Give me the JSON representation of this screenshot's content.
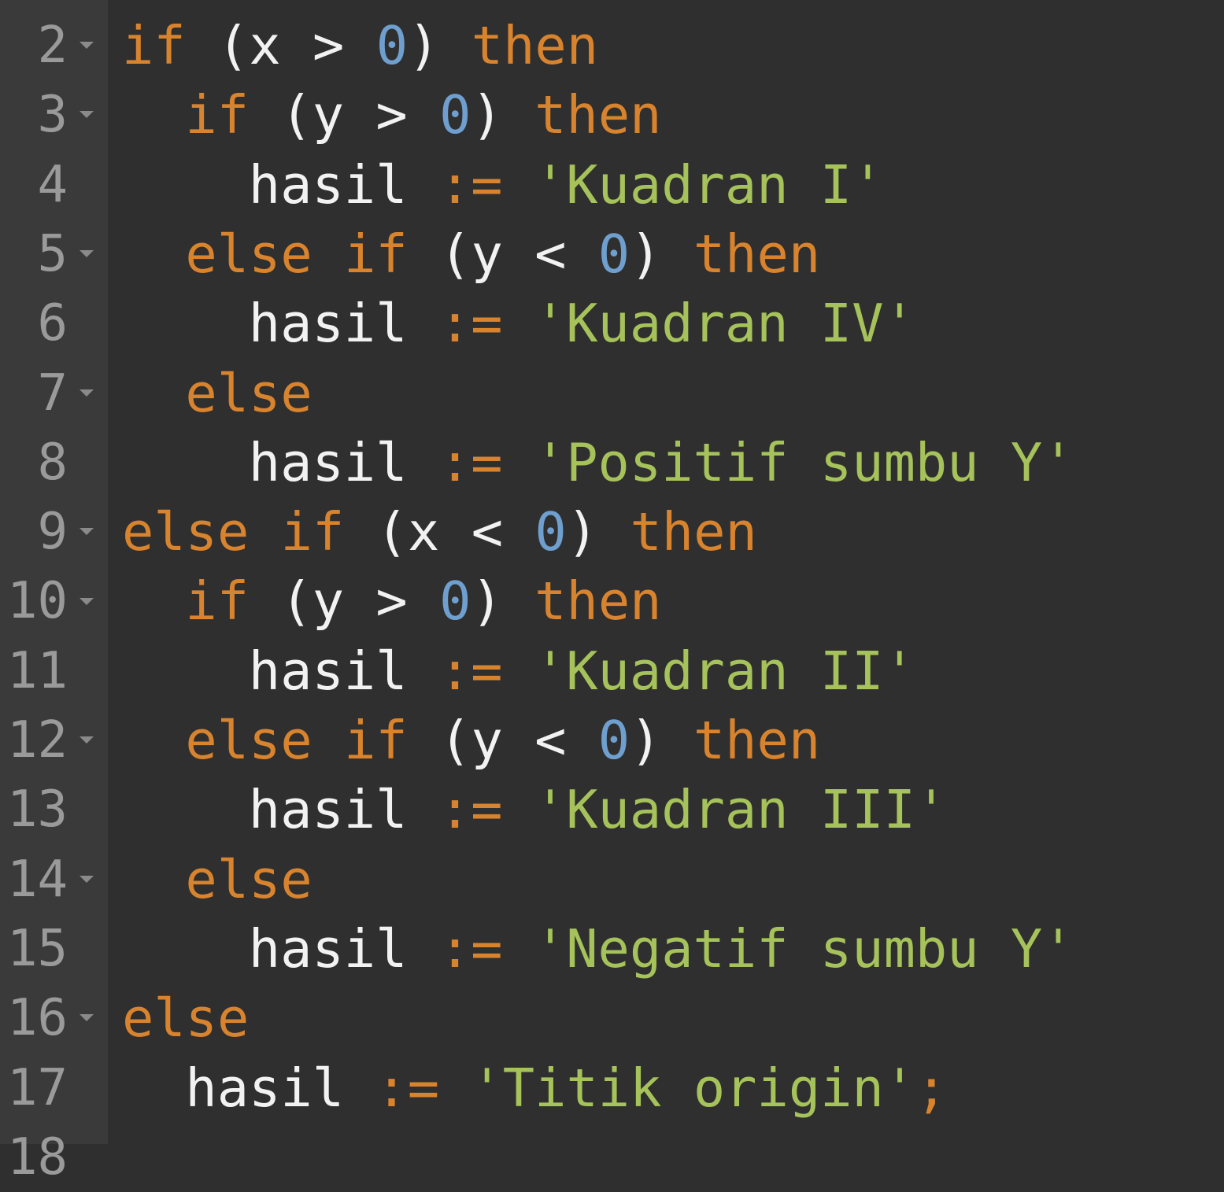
{
  "editor": {
    "colors": {
      "background": "#2f2f2f",
      "gutter": "#3a3a3a",
      "keyword": "#d8832e",
      "number": "#6f9fcf",
      "string": "#a6c25a",
      "text": "#f2f2f2"
    },
    "lines": [
      {
        "n": "2",
        "fold": true,
        "indent": 0,
        "tokens": [
          {
            "t": "if",
            "c": "kw"
          },
          {
            "t": " (x > ",
            "c": "plain"
          },
          {
            "t": "0",
            "c": "num"
          },
          {
            "t": ") ",
            "c": "plain"
          },
          {
            "t": "then",
            "c": "kw"
          }
        ]
      },
      {
        "n": "3",
        "fold": true,
        "indent": 1,
        "tokens": [
          {
            "t": "if",
            "c": "kw"
          },
          {
            "t": " (y > ",
            "c": "plain"
          },
          {
            "t": "0",
            "c": "num"
          },
          {
            "t": ") ",
            "c": "plain"
          },
          {
            "t": "then",
            "c": "kw"
          }
        ]
      },
      {
        "n": "4",
        "fold": false,
        "indent": 2,
        "tokens": [
          {
            "t": "hasil ",
            "c": "plain"
          },
          {
            "t": ":=",
            "c": "op"
          },
          {
            "t": " ",
            "c": "plain"
          },
          {
            "t": "'Kuadran I'",
            "c": "str"
          }
        ]
      },
      {
        "n": "5",
        "fold": true,
        "indent": 1,
        "tokens": [
          {
            "t": "else if",
            "c": "kw"
          },
          {
            "t": " (y < ",
            "c": "plain"
          },
          {
            "t": "0",
            "c": "num"
          },
          {
            "t": ") ",
            "c": "plain"
          },
          {
            "t": "then",
            "c": "kw"
          }
        ]
      },
      {
        "n": "6",
        "fold": false,
        "indent": 2,
        "tokens": [
          {
            "t": "hasil ",
            "c": "plain"
          },
          {
            "t": ":=",
            "c": "op"
          },
          {
            "t": " ",
            "c": "plain"
          },
          {
            "t": "'Kuadran IV'",
            "c": "str"
          }
        ]
      },
      {
        "n": "7",
        "fold": true,
        "indent": 1,
        "tokens": [
          {
            "t": "else",
            "c": "kw"
          }
        ]
      },
      {
        "n": "8",
        "fold": false,
        "indent": 2,
        "tokens": [
          {
            "t": "hasil ",
            "c": "plain"
          },
          {
            "t": ":=",
            "c": "op"
          },
          {
            "t": " ",
            "c": "plain"
          },
          {
            "t": "'Positif sumbu Y'",
            "c": "str"
          }
        ]
      },
      {
        "n": "9",
        "fold": true,
        "indent": 0,
        "tokens": [
          {
            "t": "else if",
            "c": "kw"
          },
          {
            "t": " (x < ",
            "c": "plain"
          },
          {
            "t": "0",
            "c": "num"
          },
          {
            "t": ") ",
            "c": "plain"
          },
          {
            "t": "then",
            "c": "kw"
          }
        ]
      },
      {
        "n": "10",
        "fold": true,
        "indent": 1,
        "tokens": [
          {
            "t": "if",
            "c": "kw"
          },
          {
            "t": " (y > ",
            "c": "plain"
          },
          {
            "t": "0",
            "c": "num"
          },
          {
            "t": ") ",
            "c": "plain"
          },
          {
            "t": "then",
            "c": "kw"
          }
        ]
      },
      {
        "n": "11",
        "fold": false,
        "indent": 2,
        "tokens": [
          {
            "t": "hasil ",
            "c": "plain"
          },
          {
            "t": ":=",
            "c": "op"
          },
          {
            "t": " ",
            "c": "plain"
          },
          {
            "t": "'Kuadran II'",
            "c": "str"
          }
        ]
      },
      {
        "n": "12",
        "fold": true,
        "indent": 1,
        "tokens": [
          {
            "t": "else if",
            "c": "kw"
          },
          {
            "t": " (y < ",
            "c": "plain"
          },
          {
            "t": "0",
            "c": "num"
          },
          {
            "t": ") ",
            "c": "plain"
          },
          {
            "t": "then",
            "c": "kw"
          }
        ]
      },
      {
        "n": "13",
        "fold": false,
        "indent": 2,
        "tokens": [
          {
            "t": "hasil ",
            "c": "plain"
          },
          {
            "t": ":=",
            "c": "op"
          },
          {
            "t": " ",
            "c": "plain"
          },
          {
            "t": "'Kuadran III'",
            "c": "str"
          }
        ]
      },
      {
        "n": "14",
        "fold": true,
        "indent": 1,
        "tokens": [
          {
            "t": "else",
            "c": "kw"
          }
        ]
      },
      {
        "n": "15",
        "fold": false,
        "indent": 2,
        "tokens": [
          {
            "t": "hasil ",
            "c": "plain"
          },
          {
            "t": ":=",
            "c": "op"
          },
          {
            "t": " ",
            "c": "plain"
          },
          {
            "t": "'Negatif sumbu Y'",
            "c": "str"
          }
        ]
      },
      {
        "n": "16",
        "fold": true,
        "indent": 0,
        "tokens": [
          {
            "t": "else",
            "c": "kw"
          }
        ]
      },
      {
        "n": "17",
        "fold": false,
        "indent": 1,
        "tokens": [
          {
            "t": "hasil ",
            "c": "plain"
          },
          {
            "t": ":=",
            "c": "op"
          },
          {
            "t": " ",
            "c": "plain"
          },
          {
            "t": "'Titik origin'",
            "c": "str"
          },
          {
            "t": ";",
            "c": "op"
          }
        ]
      },
      {
        "n": "18",
        "fold": false,
        "indent": 0,
        "tokens": []
      }
    ]
  }
}
